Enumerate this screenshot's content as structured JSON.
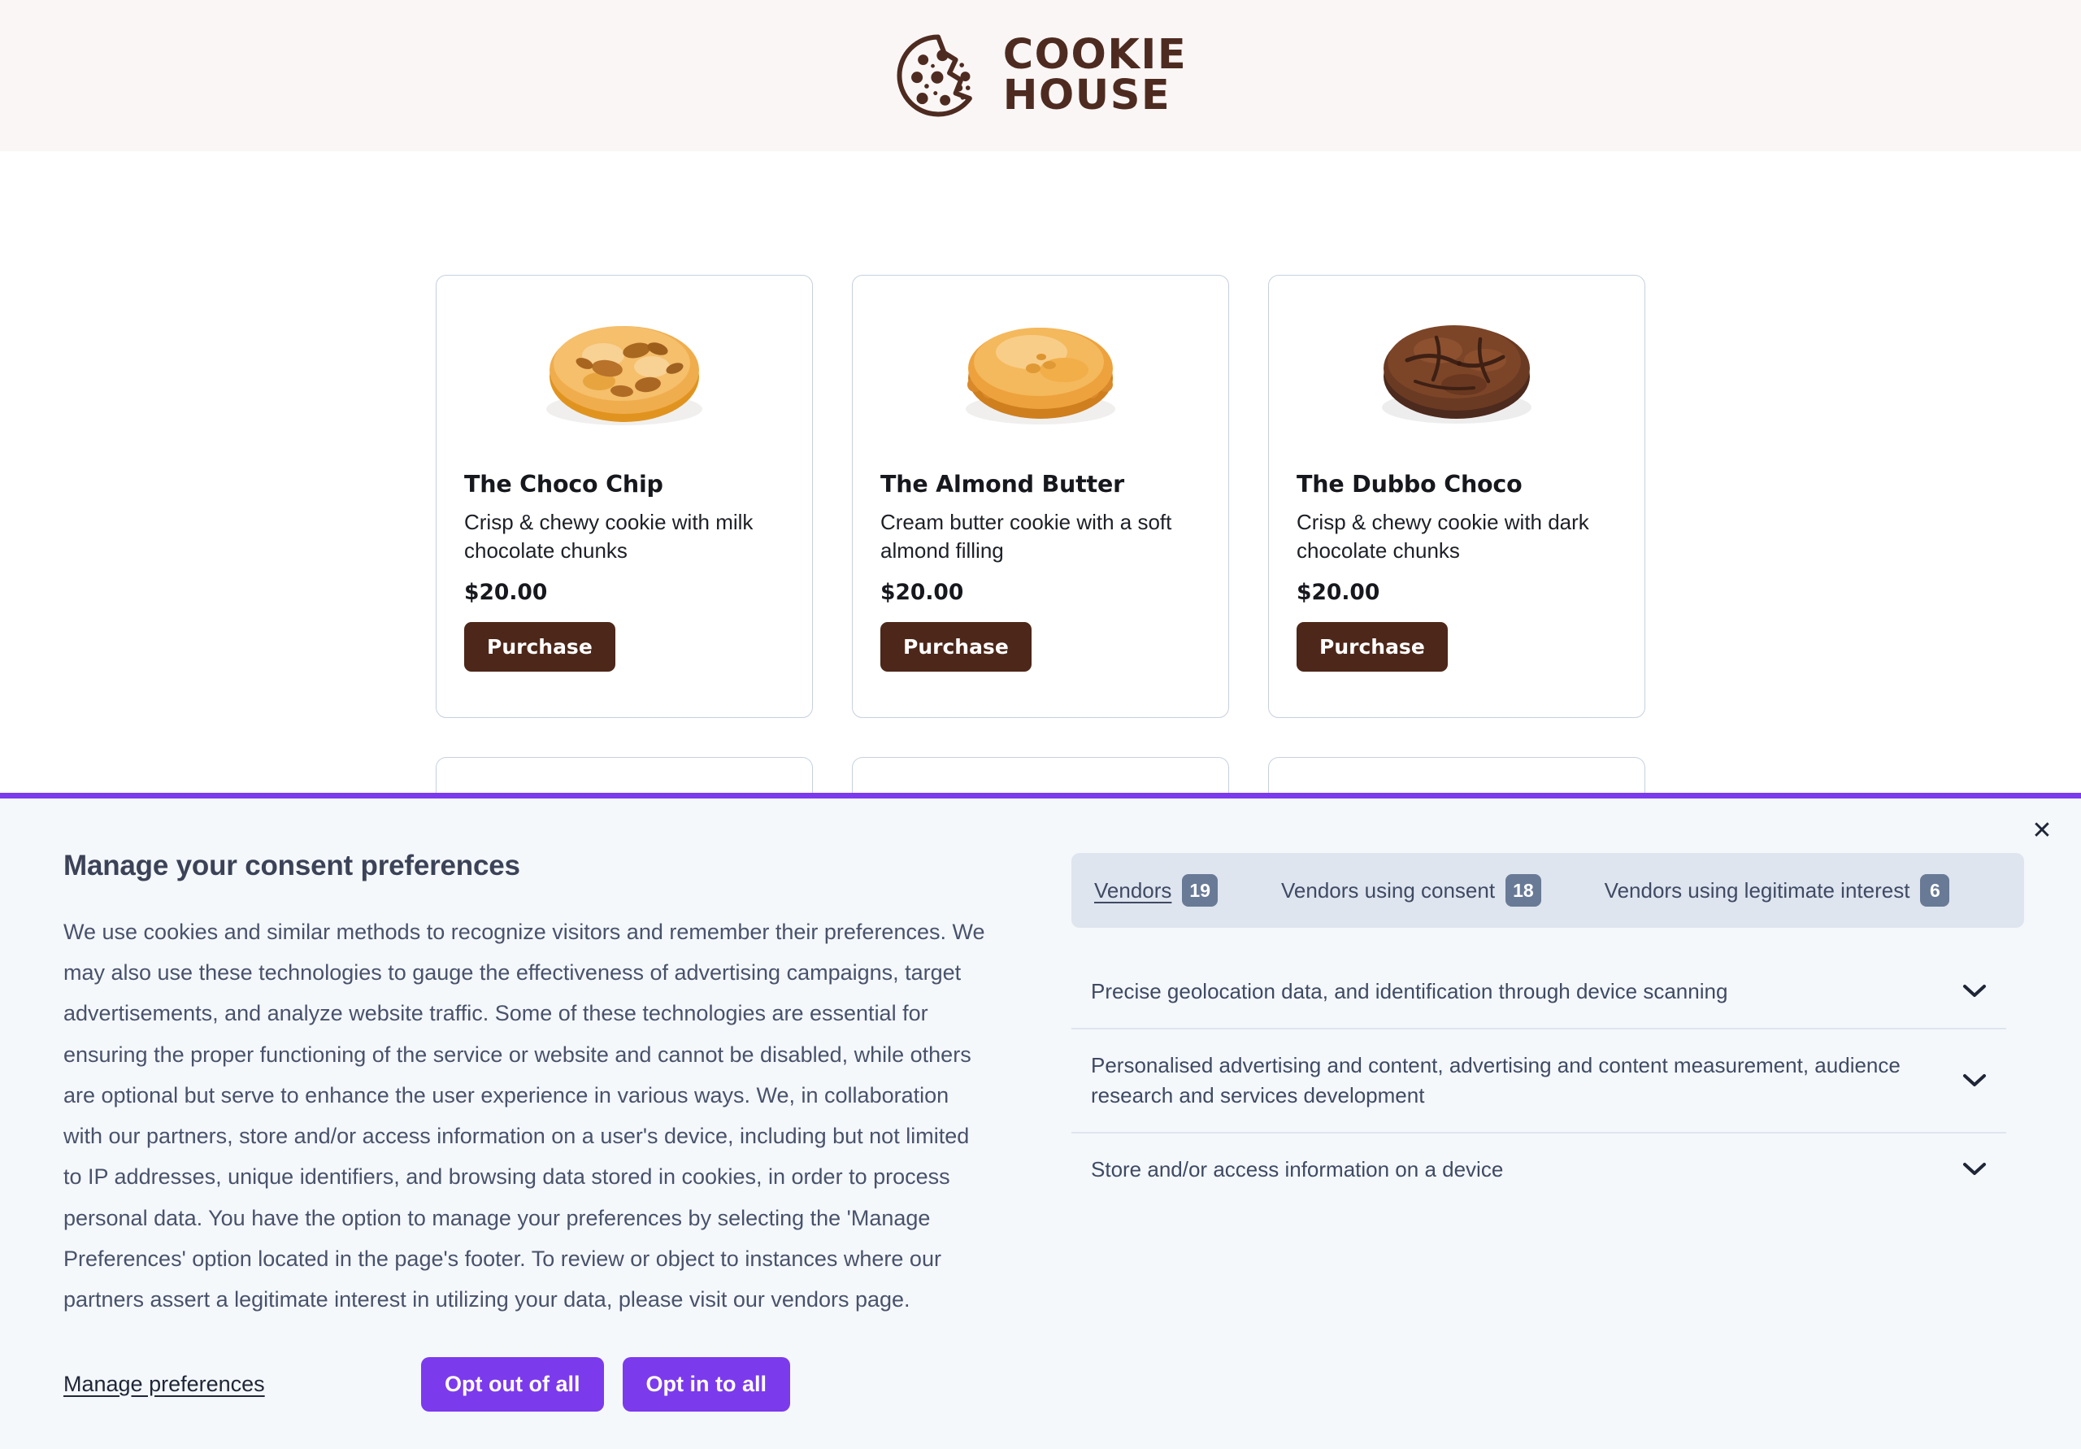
{
  "site": {
    "brand_line1": "COOKIE",
    "brand_line2": "HOUSE",
    "brand_color": "#4e2b20",
    "header_bg": "#faf6f5"
  },
  "catalog": {
    "products": [
      {
        "title": "The Choco Chip",
        "description": "Crisp & chewy cookie with milk chocolate chunks",
        "price": "$20.00",
        "purchase_label": "Purchase",
        "image": "chocolate-chip-cookie"
      },
      {
        "title": "The Almond Butter",
        "description": "Cream butter cookie with a soft almond filling",
        "price": "$20.00",
        "purchase_label": "Purchase",
        "image": "almond-butter-cookie"
      },
      {
        "title": "The Dubbo Choco",
        "description": "Crisp & chewy cookie with dark chocolate chunks",
        "price": "$20.00",
        "purchase_label": "Purchase",
        "image": "dark-chocolate-cookie"
      }
    ]
  },
  "consent": {
    "accent_color": "#7c3aed",
    "background": "#f4f8fb",
    "close_glyph": "✕",
    "title": "Manage your consent preferences",
    "body": "We use cookies and similar methods to recognize visitors and remember their preferences. We may also use these technologies to gauge the effectiveness of advertising campaigns, target advertisements, and analyze website traffic. Some of these technologies are essential for ensuring the proper functioning of the service or website and cannot be disabled, while others are optional but serve to enhance the user experience in various ways. We, in collaboration with our partners, store and/or access information on a user's device, including but not limited to IP addresses, unique identifiers, and browsing data stored in cookies, in order to process personal data. You have the option to manage your preferences by selecting the 'Manage Preferences' option located in the page's footer. To review or object to instances where our partners assert a legitimate interest in utilizing your data, please visit our vendors page.",
    "tabs": [
      {
        "label": "Vendors",
        "count": "19",
        "active": true
      },
      {
        "label": "Vendors using consent",
        "count": "18",
        "active": false
      },
      {
        "label": "Vendors using legitimate interest",
        "count": "6",
        "active": false
      }
    ],
    "purposes": [
      {
        "label": "Precise geolocation data, and identification through device scanning"
      },
      {
        "label": "Personalised advertising and content, advertising and content measurement, audience research and services development"
      },
      {
        "label": "Store and/or access information on a device"
      }
    ],
    "footer": {
      "manage_preferences_label": "Manage preferences",
      "opt_out_label": "Opt out of all",
      "opt_in_label": "Opt in to all"
    }
  }
}
